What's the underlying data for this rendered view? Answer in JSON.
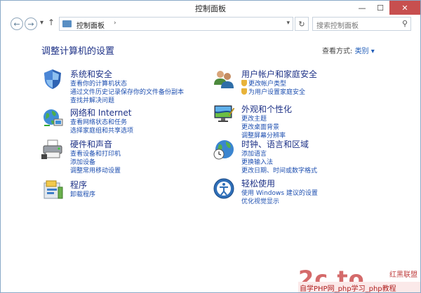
{
  "window": {
    "title": "控制面板",
    "minimize": "—",
    "maximize": "☐",
    "close": "✕"
  },
  "toolbar": {
    "back": "←",
    "forward": "→",
    "history": "▾",
    "up": "↑",
    "refresh": "↻"
  },
  "address": {
    "crumb": "控制面板",
    "arrow": "›",
    "dropdown": "▾"
  },
  "search": {
    "placeholder": "搜索控制面板",
    "icon": "⚲"
  },
  "main": {
    "heading": "调整计算机的设置",
    "view_by_label": "查看方式:",
    "view_by_value": "类别 ▾"
  },
  "categories": [
    {
      "title": "系统和安全",
      "icon": "shield-icon",
      "links": [
        "查看你的计算机状态",
        "通过文件历史记录保存你的文件备份副本",
        "查找并解决问题"
      ]
    },
    {
      "title": "网络和 Internet",
      "icon": "network-icon",
      "links": [
        "查看网络状态和任务",
        "选择家庭组和共享选项"
      ]
    },
    {
      "title": "硬件和声音",
      "icon": "printer-icon",
      "links": [
        "查看设备和打印机",
        "添加设备",
        "调整常用移动设置"
      ]
    },
    {
      "title": "程序",
      "icon": "programs-icon",
      "links": [
        "卸载程序"
      ]
    },
    {
      "title": "用户帐户和家庭安全",
      "icon": "users-icon",
      "links": [
        "更改帐户类型",
        "为用户设置家庭安全"
      ]
    },
    {
      "title": "外观和个性化",
      "icon": "monitor-icon",
      "links": [
        "更改主题",
        "更改桌面背景",
        "调整屏幕分辨率"
      ]
    },
    {
      "title": "时钟、语言和区域",
      "icon": "clock-globe-icon",
      "links": [
        "添加语言",
        "更换输入法",
        "更改日期、时间或数字格式"
      ]
    },
    {
      "title": "轻松使用",
      "icon": "ease-of-access-icon",
      "links": [
        "使用 Windows 建议的设置",
        "优化视觉显示"
      ]
    }
  ],
  "watermark": {
    "logo": "2c to",
    "brand": "红黑联盟",
    "text": "自学PHP网_php学习_php教程"
  }
}
